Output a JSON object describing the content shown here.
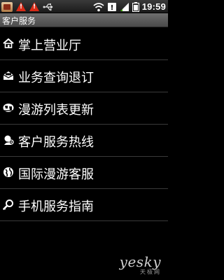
{
  "status_bar": {
    "time": "19:59",
    "icons": [
      "app-icon",
      "warning-icon",
      "warning-icon",
      "usb-icon",
      "wifi-icon",
      "mail-icon",
      "signal-icon",
      "battery-icon"
    ]
  },
  "title_bar": {
    "title": "客户服务"
  },
  "menu": {
    "items": [
      {
        "label": "掌上营业厅",
        "icon": "home-icon"
      },
      {
        "label": "业务查询退订",
        "icon": "mail-open-icon"
      },
      {
        "label": "漫游列表更新",
        "icon": "globe-list-icon"
      },
      {
        "label": "客户服务热线",
        "icon": "headset-icon"
      },
      {
        "label": "国际漫游客服",
        "icon": "globe-icon"
      },
      {
        "label": "手机服务指南",
        "icon": "search-icon"
      }
    ]
  },
  "watermark": {
    "brand": "yesky",
    "sub": "天极网"
  }
}
